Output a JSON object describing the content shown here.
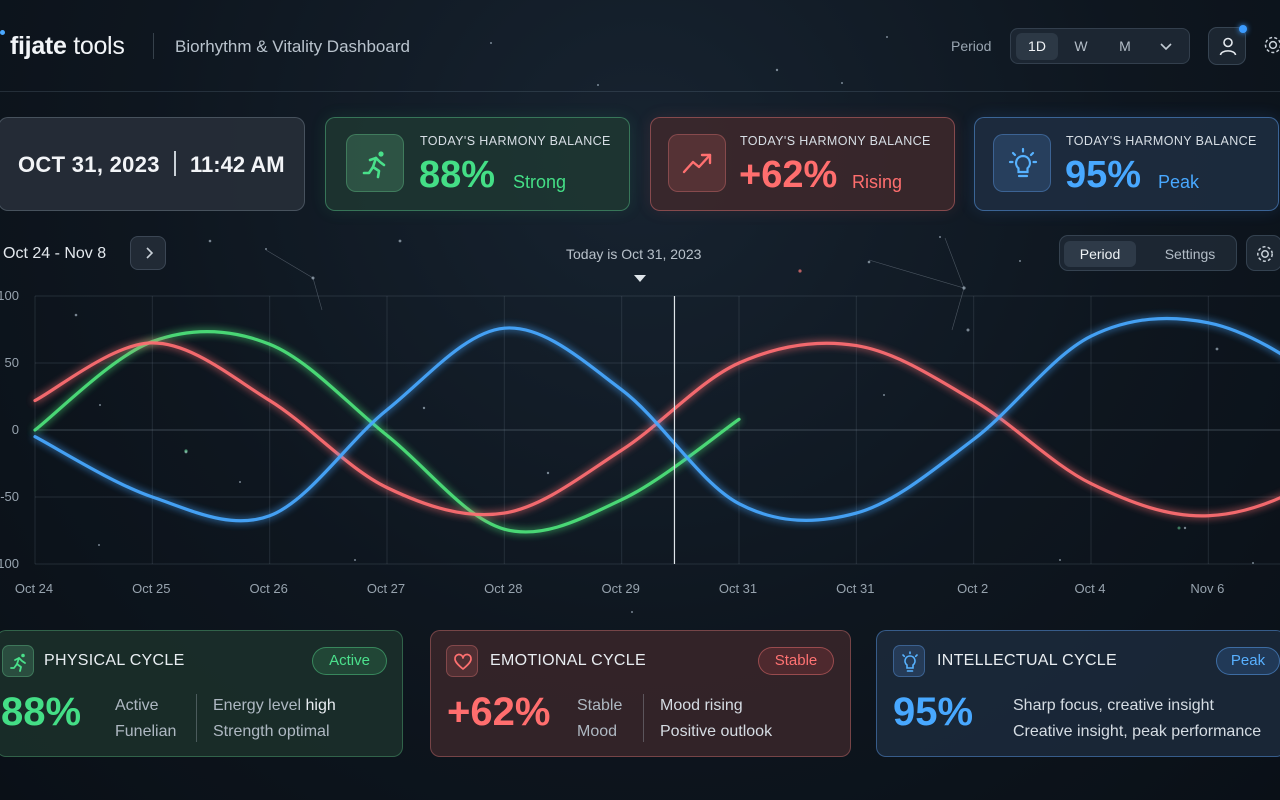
{
  "header": {
    "logo_bold": "fijate",
    "logo_rest": " tools",
    "title": "Biorhythm & Vitality Dashboard",
    "period_label": "Period",
    "period_options": [
      "1D",
      "W",
      "M"
    ],
    "selected_period": "1D"
  },
  "datetime": {
    "date": "OCT 31, 2023",
    "time": "11:42 AM"
  },
  "stats": [
    {
      "kicker": "TODAY'S HARMONY BALANCE",
      "value": "88%",
      "status": "Strong",
      "icon": "running-icon",
      "color": "#3ddc84"
    },
    {
      "kicker": "TODAY'S HARMONY BALANCE",
      "value": "+62%",
      "status": "Rising",
      "icon": "trend-up-icon",
      "color": "#ff6b6b"
    },
    {
      "kicker": "TODAY'S HARMONY BALANCE",
      "value": "95%",
      "status": "Peak",
      "icon": "lightbulb-icon",
      "color": "#45a8ff"
    }
  ],
  "chart_controls": {
    "range": "Oct 24 - Nov 8",
    "today": "Today is Oct 31, 2023",
    "tabs": [
      "Period",
      "Settings"
    ],
    "active_tab": "Period"
  },
  "chart_data": {
    "type": "line",
    "x": [
      "Oct 24",
      "Oct 25",
      "Oct 26",
      "Oct 27",
      "Oct 28",
      "Oct 29",
      "Oct 31",
      "Oct 31",
      "Oct 2",
      "Oct 4",
      "Nov 6",
      "Nov"
    ],
    "ylim": [
      -100,
      100
    ],
    "yticks": [
      "100",
      "50",
      "0",
      "-50",
      "-100"
    ],
    "today_index": 5.45,
    "grid": true,
    "series": [
      {
        "color": "#4de27a",
        "values": [
          0,
          66,
          64,
          -4,
          -74,
          -52,
          8
        ]
      },
      {
        "color": "#ff6e72",
        "values": [
          22,
          65,
          22,
          -43,
          -62,
          -15,
          50,
          63,
          22,
          -40,
          -64,
          -32,
          50
        ]
      },
      {
        "color": "#47a8ff",
        "values": [
          -5,
          -50,
          -64,
          15,
          76,
          30,
          -55,
          -62,
          -7,
          70,
          80,
          35,
          -40
        ]
      }
    ]
  },
  "cycles": [
    {
      "title": "PHYSICAL CYCLE",
      "badge": "Active",
      "value": "88%",
      "col1": [
        "Active",
        "Funelian"
      ],
      "col2_prefix": [
        "Energy level ",
        "Strength optimal"
      ],
      "col2_bold": [
        "high",
        ""
      ],
      "icon": "running-icon",
      "color": "#3ddc84"
    },
    {
      "title": "EMOTIONAL CYCLE",
      "badge": "Stable",
      "value": "+62%",
      "col1": [
        "Stable",
        "Mood"
      ],
      "col2_prefix": [
        "Mood rising",
        "Positive outlook"
      ],
      "col2_bold": [
        "",
        ""
      ],
      "icon": "heart-icon",
      "color": "#ff6b6b"
    },
    {
      "title": "INTELLECTUAL CYCLE",
      "badge": "Peak",
      "value": "95%",
      "col1": [
        "Sharp focus, creative insight",
        "Creative insight, peak performance"
      ],
      "icon": "lightbulb-icon",
      "color": "#45a8ff"
    }
  ]
}
